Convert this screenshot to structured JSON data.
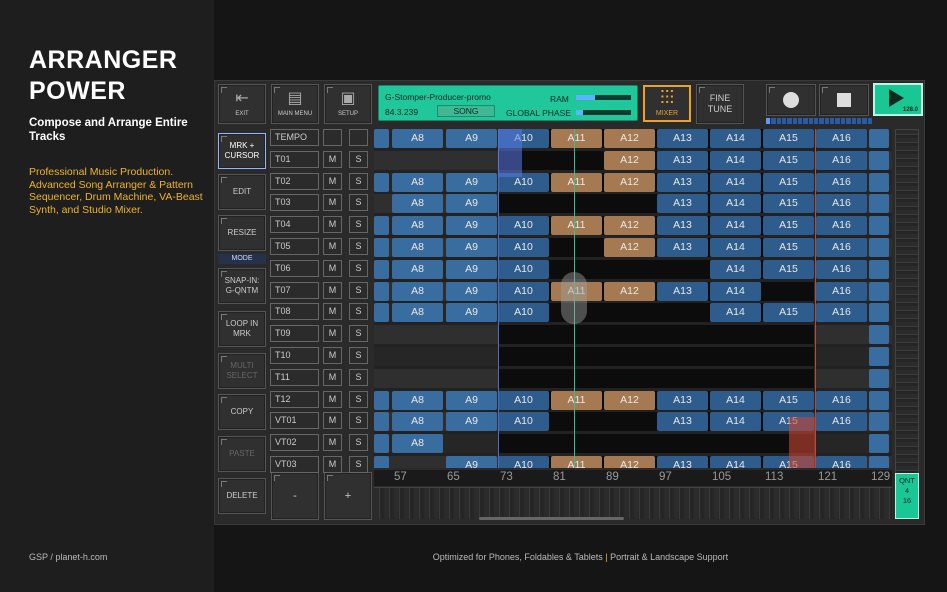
{
  "promo": {
    "title": "ARRANGER POWER",
    "subtitle": "Compose and Arrange Entire Tracks",
    "description": "Professional Music Production. Advanced Song Arranger & Pattern Sequencer, Drum Machine, VA-Beast Synth, and Studio Mixer.",
    "footer_left": "GSP / planet-h.com",
    "footer_center_a": "Optimized for Phones, Foldables & Tablets",
    "footer_sep": "|",
    "footer_center_b": "Portrait & Landscape Support"
  },
  "toolbar": {
    "exit": "EXIT",
    "main_menu": "MAIN MENU",
    "setup": "SETUP",
    "mixer": "MIXER",
    "fine_tune": "FINE TUNE",
    "tempo_display": "128.0"
  },
  "info": {
    "song_name": "G-Stomper-Producer-promo",
    "position": "84.3.239",
    "mode": "SONG",
    "ram_label": "RAM",
    "global_phase_label": "GLOBAL PHASE"
  },
  "side_buttons": {
    "mrk_cursor": "MRK + CURSOR",
    "edit": "EDIT",
    "resize": "RESIZE",
    "mode_label": "MODE",
    "snap_in": "SNAP-IN: G-QNTM",
    "loop_in_mrk": "LOOP IN MRK",
    "multi_select": "MULTI SELECT",
    "copy": "COPY",
    "paste": "PASTE",
    "delete": "DELETE",
    "minus": "-",
    "plus": "+"
  },
  "qnt": {
    "label": "QNT",
    "num": "4",
    "den": "16"
  },
  "tracks": [
    {
      "name": "TEMPO",
      "m": "",
      "s": ""
    },
    {
      "name": "T01",
      "m": "M",
      "s": "S"
    },
    {
      "name": "T02",
      "m": "M",
      "s": "S"
    },
    {
      "name": "T03",
      "m": "M",
      "s": "S"
    },
    {
      "name": "T04",
      "m": "M",
      "s": "S"
    },
    {
      "name": "T05",
      "m": "M",
      "s": "S"
    },
    {
      "name": "T06",
      "m": "M",
      "s": "S"
    },
    {
      "name": "T07",
      "m": "M",
      "s": "S"
    },
    {
      "name": "T08",
      "m": "M",
      "s": "S"
    },
    {
      "name": "T09",
      "m": "M",
      "s": "S"
    },
    {
      "name": "T10",
      "m": "M",
      "s": "S"
    },
    {
      "name": "T11",
      "m": "M",
      "s": "S"
    },
    {
      "name": "T12",
      "m": "M",
      "s": "S"
    },
    {
      "name": "VT01",
      "m": "M",
      "s": "S"
    },
    {
      "name": "VT02",
      "m": "M",
      "s": "S"
    },
    {
      "name": "VT03",
      "m": "M",
      "s": "S"
    }
  ],
  "ruler": [
    "57",
    "65",
    "73",
    "81",
    "89",
    "97",
    "105",
    "113",
    "121",
    "129"
  ],
  "lanes": [
    [
      "A8",
      "A9",
      "A10",
      "A11",
      "A12",
      "A13",
      "A14",
      "A15",
      "A16"
    ],
    [
      "",
      "",
      "",
      "",
      "A12",
      "A13",
      "A14",
      "A15",
      "A16"
    ],
    [
      "A8",
      "A9",
      "A10",
      "A11",
      "A12",
      "A13",
      "A14",
      "A15",
      "A16"
    ],
    [
      "A8",
      "A9",
      "",
      "",
      "",
      "A13",
      "A14",
      "A15",
      "A16"
    ],
    [
      "A8",
      "A9",
      "A10",
      "A11",
      "A12",
      "A13",
      "A14",
      "A15",
      "A16"
    ],
    [
      "A8",
      "A9",
      "A10",
      "",
      "A12",
      "A13",
      "A14",
      "A15",
      "A16"
    ],
    [
      "A8",
      "A9",
      "A10",
      "",
      "",
      "",
      "A14",
      "A15",
      "A16"
    ],
    [
      "A8",
      "A9",
      "A10",
      "A11",
      "A12",
      "A13",
      "A14",
      "",
      "A16"
    ],
    [
      "A8",
      "A9",
      "A10",
      "",
      "",
      "",
      "A14",
      "A15",
      "A16"
    ],
    [
      "",
      "",
      "",
      "",
      "",
      "",
      "",
      "",
      ""
    ],
    [
      "",
      "",
      "",
      "",
      "",
      "",
      "",
      "",
      ""
    ],
    [
      "",
      "",
      "",
      "",
      "",
      "",
      "",
      "",
      ""
    ],
    [
      "A8",
      "A9",
      "A10",
      "A11",
      "A12",
      "A13",
      "A14",
      "A15",
      "A16"
    ],
    [
      "A8",
      "A9",
      "A10",
      "",
      "",
      "A13",
      "A14",
      "A15",
      "A16"
    ],
    [
      "A8",
      "",
      "",
      "",
      "",
      "",
      "",
      "",
      ""
    ],
    [
      "",
      "A9",
      "A10",
      "A11",
      "A12",
      "A13",
      "A14",
      "A15",
      "A16"
    ]
  ]
}
